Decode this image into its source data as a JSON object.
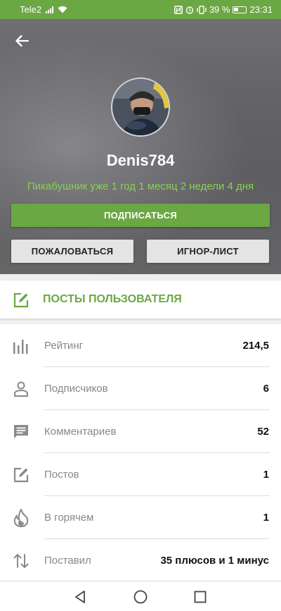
{
  "status_bar": {
    "carrier": "Tele2",
    "battery": "39 %",
    "time": "23:31",
    "icons": [
      "signal-icon",
      "wifi-icon",
      "nfc-icon",
      "alarm-icon",
      "vibrate-icon",
      "battery-icon"
    ]
  },
  "profile": {
    "username": "Denis784",
    "since": "Пикабушник уже 1 год 1 месяц 2 недели 4 дня",
    "subscribe_label": "ПОДПИСАТЬСЯ",
    "complain_label": "ПОЖАЛОВАТЬСЯ",
    "ignore_label": "ИГНОР-ЛИСТ"
  },
  "posts_link": {
    "label": "ПОСТЫ ПОЛЬЗОВАТЕЛЯ",
    "icon": "edit-icon"
  },
  "stats": [
    {
      "icon": "rating-icon",
      "label": "Рейтинг",
      "value": "214,5"
    },
    {
      "icon": "subscribers-icon",
      "label": "Подписчиков",
      "value": "6"
    },
    {
      "icon": "comments-icon",
      "label": "Комментариев",
      "value": "52"
    },
    {
      "icon": "posts-icon",
      "label": "Постов",
      "value": "1"
    },
    {
      "icon": "hot-icon",
      "label": "В горячем",
      "value": "1"
    },
    {
      "icon": "votes-icon",
      "label": "Поставил",
      "value": "35 плюсов и 1 минус"
    }
  ],
  "colors": {
    "accent": "#6ba743",
    "since_text": "#8ad050",
    "button_gray": "#e4e4e4"
  }
}
